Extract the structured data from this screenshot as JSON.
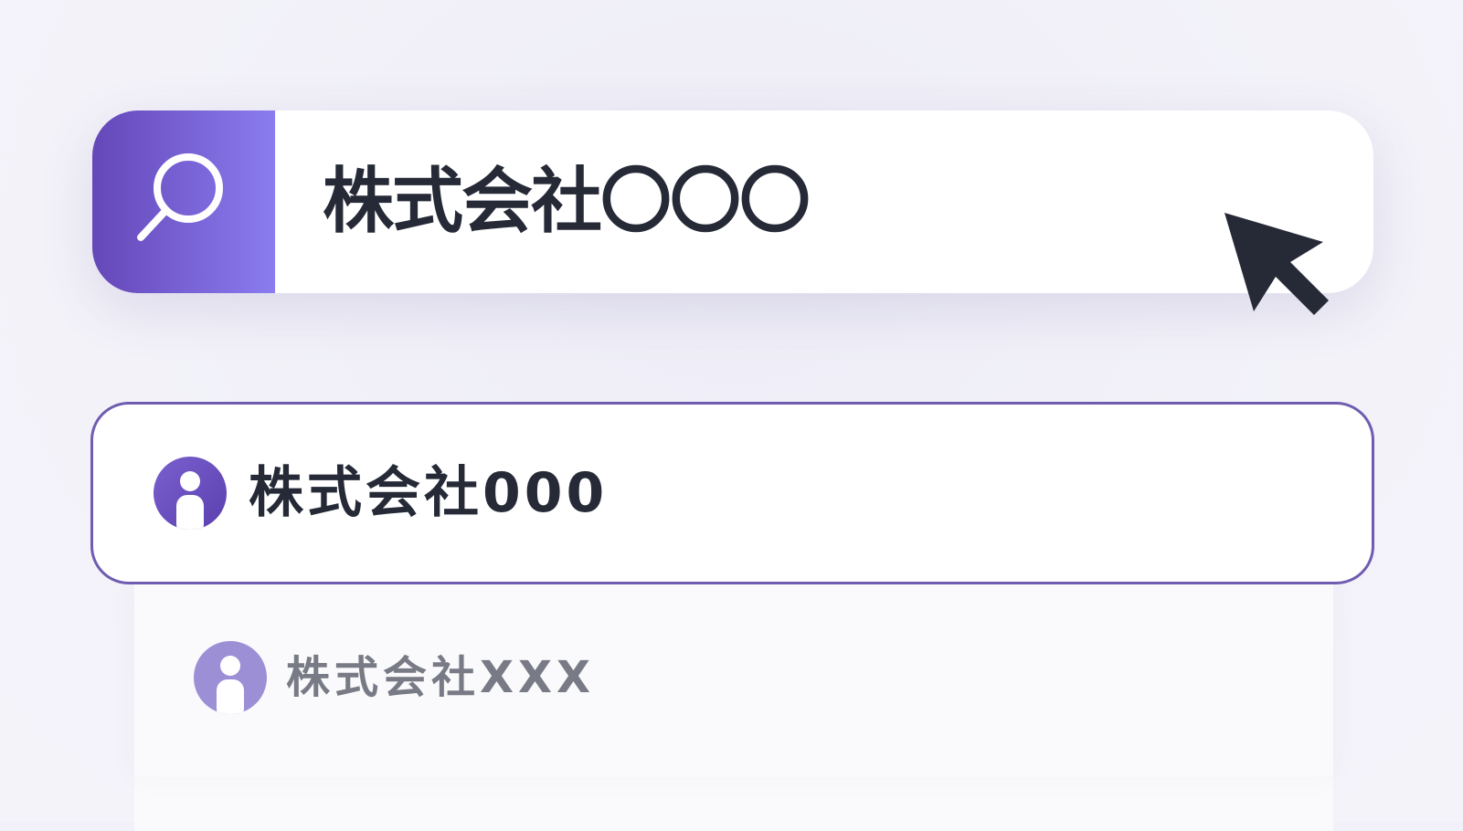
{
  "search": {
    "query": "株式会社〇〇〇",
    "button_icon": "search-icon",
    "accent_gradient": [
      "#6547b8",
      "#8a7cf0"
    ]
  },
  "results": [
    {
      "label": "株式会社000",
      "icon": "person-icon",
      "selected": true,
      "avatar_color": "#6d52c3"
    },
    {
      "label": "株式会社XXX",
      "icon": "person-icon",
      "selected": false,
      "avatar_color": "#9c8fd6"
    }
  ],
  "colors": {
    "background": "#f2f1f9",
    "text_primary": "#262a37",
    "text_secondary": "#787a85",
    "selected_border": "#6f5cb0"
  },
  "cursor": {
    "icon": "mouse-pointer-icon"
  }
}
